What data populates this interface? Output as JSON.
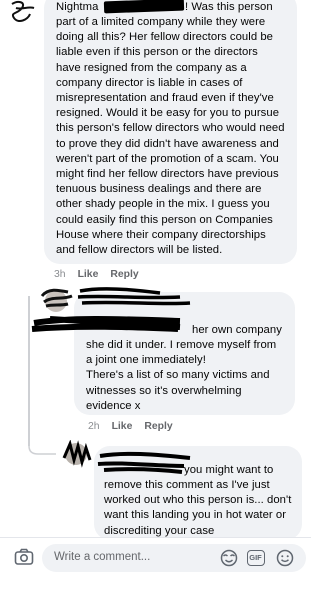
{
  "comments": [
    {
      "text_first_line": "Nightma",
      "text_first_line_end": "! Was this person",
      "text_body": "part of a limited company while they were doing all this? Her fellow directors could be liable even if this person or the directors have resigned from the company as a company director is liable in cases of misrepresentation and fraud even if they've resigned. Would it be easy for you to pursue this person's fellow directors who would need to prove they did didn't have awareness and weren't part of the promotion of a scam. You might find her fellow directors have previous tenuous business dealings and there are other shady people in the mix. I guess you could easily find this person on Companies House where their company directorships and fellow directors will be listed.",
      "time": "3h",
      "like_label": "Like",
      "reply_label": "Reply"
    },
    {
      "text_first_line_end": "her own company",
      "text_body": "she did it under. I remove myself from a joint one immediately!\nThere's a list of so many victims and witnesses so it's overwhelming evidence x",
      "time": "2h",
      "like_label": "Like",
      "reply_label": "Reply"
    },
    {
      "text_first_line_end": "you might want to",
      "text_body": "remove this comment as I've just worked out who this person is... don't want this landing you in hot water or discrediting your case"
    }
  ],
  "composer": {
    "placeholder": "Write a comment...",
    "gif_label": "GIF",
    "icons": [
      "camera-icon",
      "sticker-icon",
      "gif-icon",
      "emoji-icon"
    ]
  }
}
